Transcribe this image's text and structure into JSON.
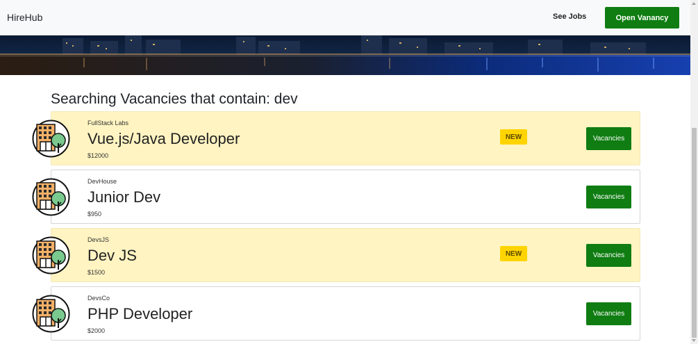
{
  "navbar": {
    "brand": "HireHub",
    "see_jobs": "See Jobs",
    "open_vacancy": "Open Vanancy"
  },
  "search": {
    "heading": "Searching Vacancies that contain: dev"
  },
  "jobs": [
    {
      "company": "FullStack Labs",
      "title": "Vue.js/Java Developer",
      "salary": "$12000",
      "badge": "NEW",
      "button": "Vacancies",
      "highlighted": true
    },
    {
      "company": "DevHouse",
      "title": "Junior Dev",
      "salary": "$950",
      "badge": "",
      "button": "Vacancies",
      "highlighted": false
    },
    {
      "company": "DevsJS",
      "title": "Dev JS",
      "salary": "$1500",
      "badge": "NEW",
      "button": "Vacancies",
      "highlighted": true
    },
    {
      "company": "DevsCo",
      "title": "PHP Developer",
      "salary": "$2000",
      "badge": "",
      "button": "Vacancies",
      "highlighted": false
    }
  ],
  "icons": {
    "company_logo": "building-tree-icon",
    "scroll_up": "triangle-up-icon",
    "scroll_down": "triangle-down-icon"
  },
  "colors": {
    "accent_green": "#0f7d12",
    "highlight_bg": "#fff4c2",
    "badge_yellow": "#ffd400"
  }
}
